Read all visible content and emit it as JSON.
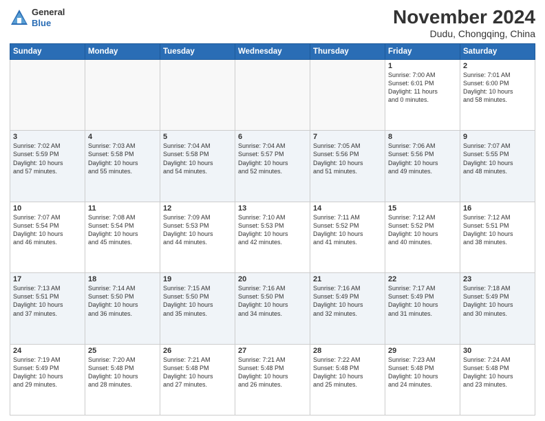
{
  "logo": {
    "general": "General",
    "blue": "Blue"
  },
  "header": {
    "month": "November 2024",
    "location": "Dudu, Chongqing, China"
  },
  "weekdays": [
    "Sunday",
    "Monday",
    "Tuesday",
    "Wednesday",
    "Thursday",
    "Friday",
    "Saturday"
  ],
  "weeks": [
    [
      {
        "day": "",
        "info": ""
      },
      {
        "day": "",
        "info": ""
      },
      {
        "day": "",
        "info": ""
      },
      {
        "day": "",
        "info": ""
      },
      {
        "day": "",
        "info": ""
      },
      {
        "day": "1",
        "info": "Sunrise: 7:00 AM\nSunset: 6:01 PM\nDaylight: 11 hours\nand 0 minutes."
      },
      {
        "day": "2",
        "info": "Sunrise: 7:01 AM\nSunset: 6:00 PM\nDaylight: 10 hours\nand 58 minutes."
      }
    ],
    [
      {
        "day": "3",
        "info": "Sunrise: 7:02 AM\nSunset: 5:59 PM\nDaylight: 10 hours\nand 57 minutes."
      },
      {
        "day": "4",
        "info": "Sunrise: 7:03 AM\nSunset: 5:58 PM\nDaylight: 10 hours\nand 55 minutes."
      },
      {
        "day": "5",
        "info": "Sunrise: 7:04 AM\nSunset: 5:58 PM\nDaylight: 10 hours\nand 54 minutes."
      },
      {
        "day": "6",
        "info": "Sunrise: 7:04 AM\nSunset: 5:57 PM\nDaylight: 10 hours\nand 52 minutes."
      },
      {
        "day": "7",
        "info": "Sunrise: 7:05 AM\nSunset: 5:56 PM\nDaylight: 10 hours\nand 51 minutes."
      },
      {
        "day": "8",
        "info": "Sunrise: 7:06 AM\nSunset: 5:56 PM\nDaylight: 10 hours\nand 49 minutes."
      },
      {
        "day": "9",
        "info": "Sunrise: 7:07 AM\nSunset: 5:55 PM\nDaylight: 10 hours\nand 48 minutes."
      }
    ],
    [
      {
        "day": "10",
        "info": "Sunrise: 7:07 AM\nSunset: 5:54 PM\nDaylight: 10 hours\nand 46 minutes."
      },
      {
        "day": "11",
        "info": "Sunrise: 7:08 AM\nSunset: 5:54 PM\nDaylight: 10 hours\nand 45 minutes."
      },
      {
        "day": "12",
        "info": "Sunrise: 7:09 AM\nSunset: 5:53 PM\nDaylight: 10 hours\nand 44 minutes."
      },
      {
        "day": "13",
        "info": "Sunrise: 7:10 AM\nSunset: 5:53 PM\nDaylight: 10 hours\nand 42 minutes."
      },
      {
        "day": "14",
        "info": "Sunrise: 7:11 AM\nSunset: 5:52 PM\nDaylight: 10 hours\nand 41 minutes."
      },
      {
        "day": "15",
        "info": "Sunrise: 7:12 AM\nSunset: 5:52 PM\nDaylight: 10 hours\nand 40 minutes."
      },
      {
        "day": "16",
        "info": "Sunrise: 7:12 AM\nSunset: 5:51 PM\nDaylight: 10 hours\nand 38 minutes."
      }
    ],
    [
      {
        "day": "17",
        "info": "Sunrise: 7:13 AM\nSunset: 5:51 PM\nDaylight: 10 hours\nand 37 minutes."
      },
      {
        "day": "18",
        "info": "Sunrise: 7:14 AM\nSunset: 5:50 PM\nDaylight: 10 hours\nand 36 minutes."
      },
      {
        "day": "19",
        "info": "Sunrise: 7:15 AM\nSunset: 5:50 PM\nDaylight: 10 hours\nand 35 minutes."
      },
      {
        "day": "20",
        "info": "Sunrise: 7:16 AM\nSunset: 5:50 PM\nDaylight: 10 hours\nand 34 minutes."
      },
      {
        "day": "21",
        "info": "Sunrise: 7:16 AM\nSunset: 5:49 PM\nDaylight: 10 hours\nand 32 minutes."
      },
      {
        "day": "22",
        "info": "Sunrise: 7:17 AM\nSunset: 5:49 PM\nDaylight: 10 hours\nand 31 minutes."
      },
      {
        "day": "23",
        "info": "Sunrise: 7:18 AM\nSunset: 5:49 PM\nDaylight: 10 hours\nand 30 minutes."
      }
    ],
    [
      {
        "day": "24",
        "info": "Sunrise: 7:19 AM\nSunset: 5:49 PM\nDaylight: 10 hours\nand 29 minutes."
      },
      {
        "day": "25",
        "info": "Sunrise: 7:20 AM\nSunset: 5:48 PM\nDaylight: 10 hours\nand 28 minutes."
      },
      {
        "day": "26",
        "info": "Sunrise: 7:21 AM\nSunset: 5:48 PM\nDaylight: 10 hours\nand 27 minutes."
      },
      {
        "day": "27",
        "info": "Sunrise: 7:21 AM\nSunset: 5:48 PM\nDaylight: 10 hours\nand 26 minutes."
      },
      {
        "day": "28",
        "info": "Sunrise: 7:22 AM\nSunset: 5:48 PM\nDaylight: 10 hours\nand 25 minutes."
      },
      {
        "day": "29",
        "info": "Sunrise: 7:23 AM\nSunset: 5:48 PM\nDaylight: 10 hours\nand 24 minutes."
      },
      {
        "day": "30",
        "info": "Sunrise: 7:24 AM\nSunset: 5:48 PM\nDaylight: 10 hours\nand 23 minutes."
      }
    ]
  ]
}
